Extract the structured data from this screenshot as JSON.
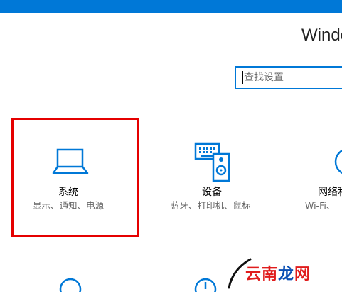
{
  "window": {
    "title": "Windo"
  },
  "search": {
    "placeholder": "查找设置"
  },
  "tiles": [
    {
      "label": "系统",
      "desc": "显示、通知、电源",
      "icon": "laptop-icon"
    },
    {
      "label": "设备",
      "desc": "蓝牙、打印机、鼠标",
      "icon": "keyboard-speaker-icon"
    },
    {
      "label": "网络和",
      "desc": "Wi-Fi、",
      "icon": "globe-icon"
    }
  ],
  "bottom_icons": [
    "account-icon",
    "time-icon"
  ],
  "watermark": {
    "part1": "云南",
    "part2": "龙",
    "part3": "网"
  },
  "colors": {
    "accent": "#0078d7",
    "highlight": "#e50000"
  }
}
